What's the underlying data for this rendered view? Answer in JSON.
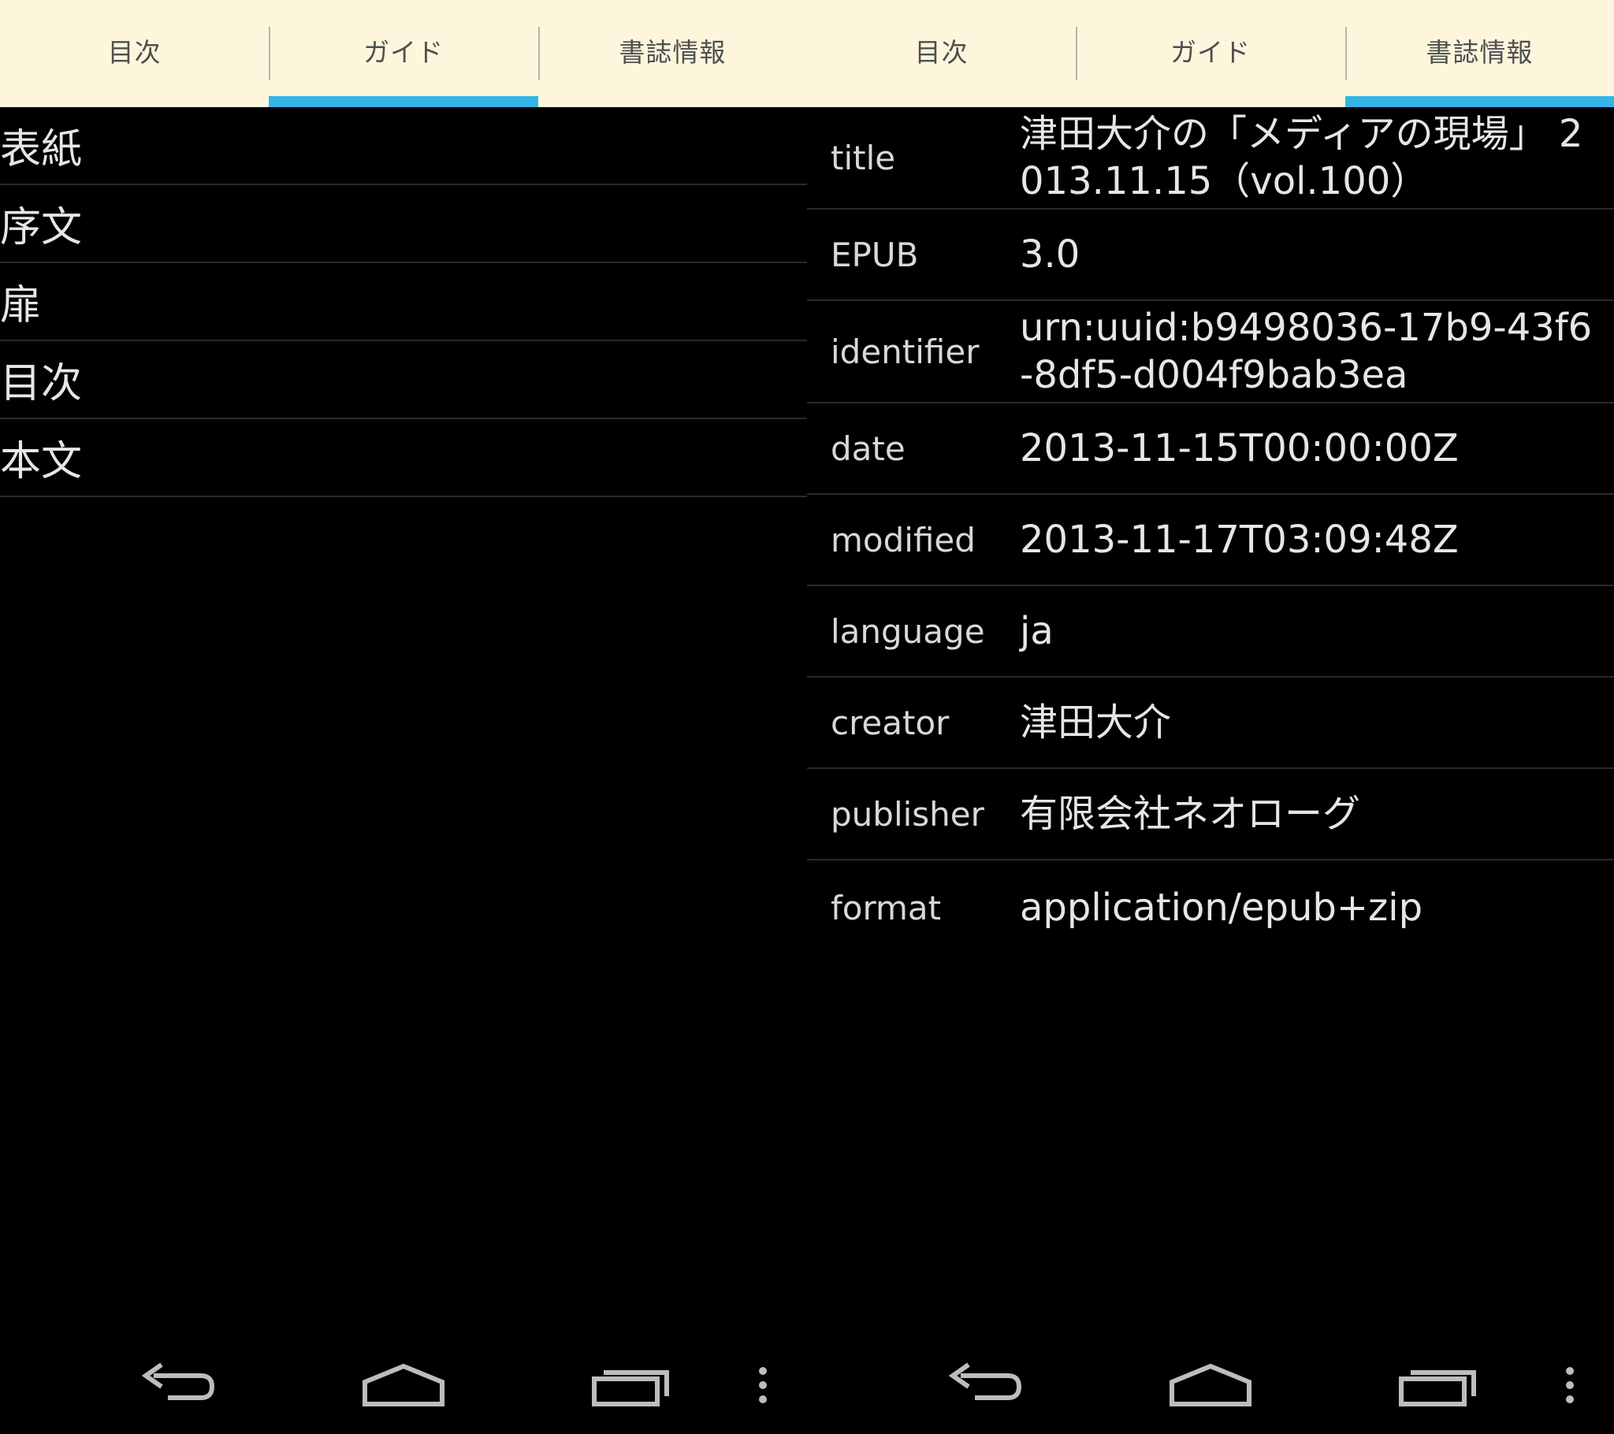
{
  "left_panel": {
    "tabs": [
      {
        "label": "目次"
      },
      {
        "label": "ガイド"
      },
      {
        "label": "書誌情報"
      }
    ],
    "active_tab": 1,
    "guide_items": [
      {
        "label": "表紙"
      },
      {
        "label": "序文"
      },
      {
        "label": "扉"
      },
      {
        "label": "目次"
      },
      {
        "label": "本文"
      }
    ]
  },
  "right_panel": {
    "tabs": [
      {
        "label": "目次"
      },
      {
        "label": "ガイド"
      },
      {
        "label": "書誌情報"
      }
    ],
    "active_tab": 2,
    "metadata": [
      {
        "key": "title",
        "value": "津田大介の「メディアの現場」 2013.11.15（vol.100）"
      },
      {
        "key": "EPUB",
        "value": "3.0"
      },
      {
        "key": "identifier",
        "value": "urn:uuid:b9498036-17b9-43f6-8df5-d004f9bab3ea"
      },
      {
        "key": "date",
        "value": "2013-11-15T00:00:00Z"
      },
      {
        "key": "modified",
        "value": "2013-11-17T03:09:48Z"
      },
      {
        "key": "language",
        "value": "ja"
      },
      {
        "key": "creator",
        "value": "津田大介"
      },
      {
        "key": "publisher",
        "value": "有限会社ネオローグ"
      },
      {
        "key": "format",
        "value": "application/epub+zip"
      }
    ]
  },
  "navbar": {
    "icons": [
      "back-icon",
      "home-icon",
      "recent-apps-icon",
      "overflow-menu-icon"
    ]
  },
  "colors": {
    "tab_bar_bg": "#fdf6dd",
    "tab_indicator": "#33b5e5",
    "content_bg": "#000000",
    "text": "#e6e6e6",
    "divider": "#2a2a2a",
    "nav_icon": "#bdbdbd"
  }
}
